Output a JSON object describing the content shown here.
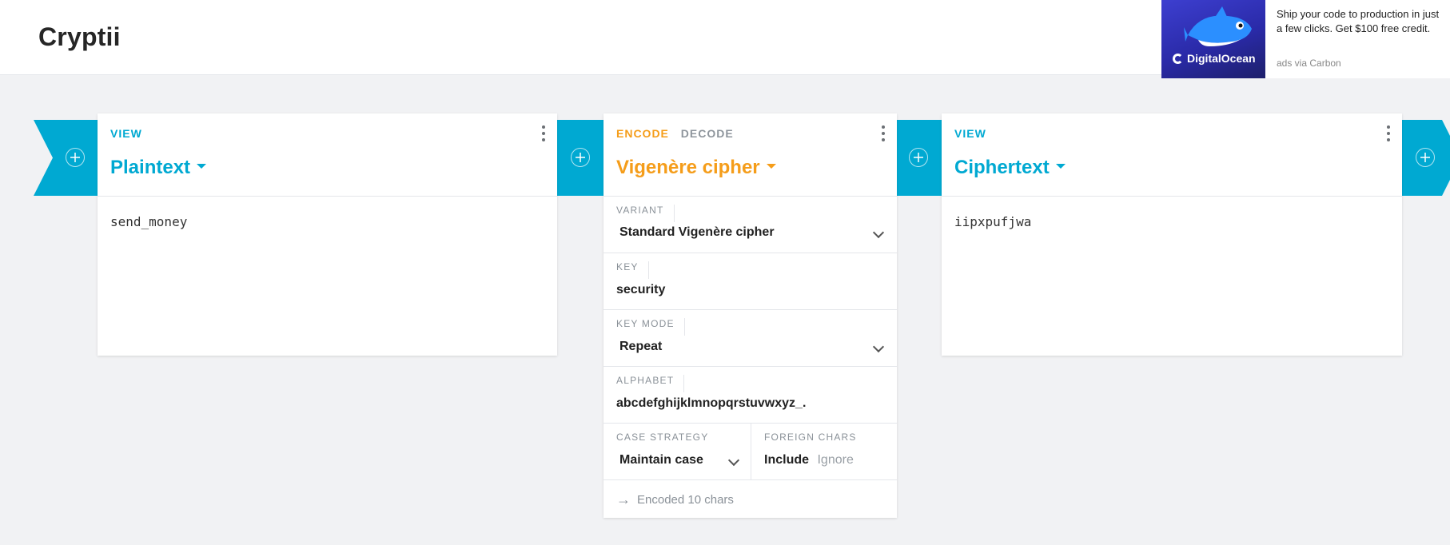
{
  "app": {
    "title": "Cryptii"
  },
  "ad": {
    "brand": "DigitalOcean",
    "text": "Ship your code to production in just a few clicks. Get $100 free credit.",
    "via": "ads via Carbon"
  },
  "bricks": [
    {
      "tabs": [
        "VIEW"
      ],
      "title": "Plaintext",
      "content": "send_money"
    },
    {
      "tabs": [
        "ENCODE",
        "DECODE"
      ],
      "active_tab": "ENCODE",
      "title": "Vigenère cipher",
      "settings": {
        "variant": {
          "label": "VARIANT",
          "value": "Standard Vigenère cipher"
        },
        "key": {
          "label": "KEY",
          "value": "security"
        },
        "key_mode": {
          "label": "KEY MODE",
          "value": "Repeat"
        },
        "alphabet": {
          "label": "ALPHABET",
          "value": "abcdefghijklmnopqrstuvwxyz_."
        },
        "case_strategy": {
          "label": "CASE STRATEGY",
          "value": "Maintain case"
        },
        "foreign_chars": {
          "label": "FOREIGN CHARS",
          "options": [
            "Include",
            "Ignore"
          ],
          "selected": "Include"
        }
      },
      "status": "Encoded 10 chars"
    },
    {
      "tabs": [
        "VIEW"
      ],
      "title": "Ciphertext",
      "content": "iipxpufjwa"
    }
  ],
  "colors": {
    "accent_blue": "#00a9d2",
    "accent_orange": "#f59d1a",
    "background": "#f1f2f4"
  },
  "icons": [
    "add-circle-icon",
    "more-vert-icon",
    "caret-down-icon",
    "chevron-down-icon",
    "arrow-right-icon"
  ]
}
